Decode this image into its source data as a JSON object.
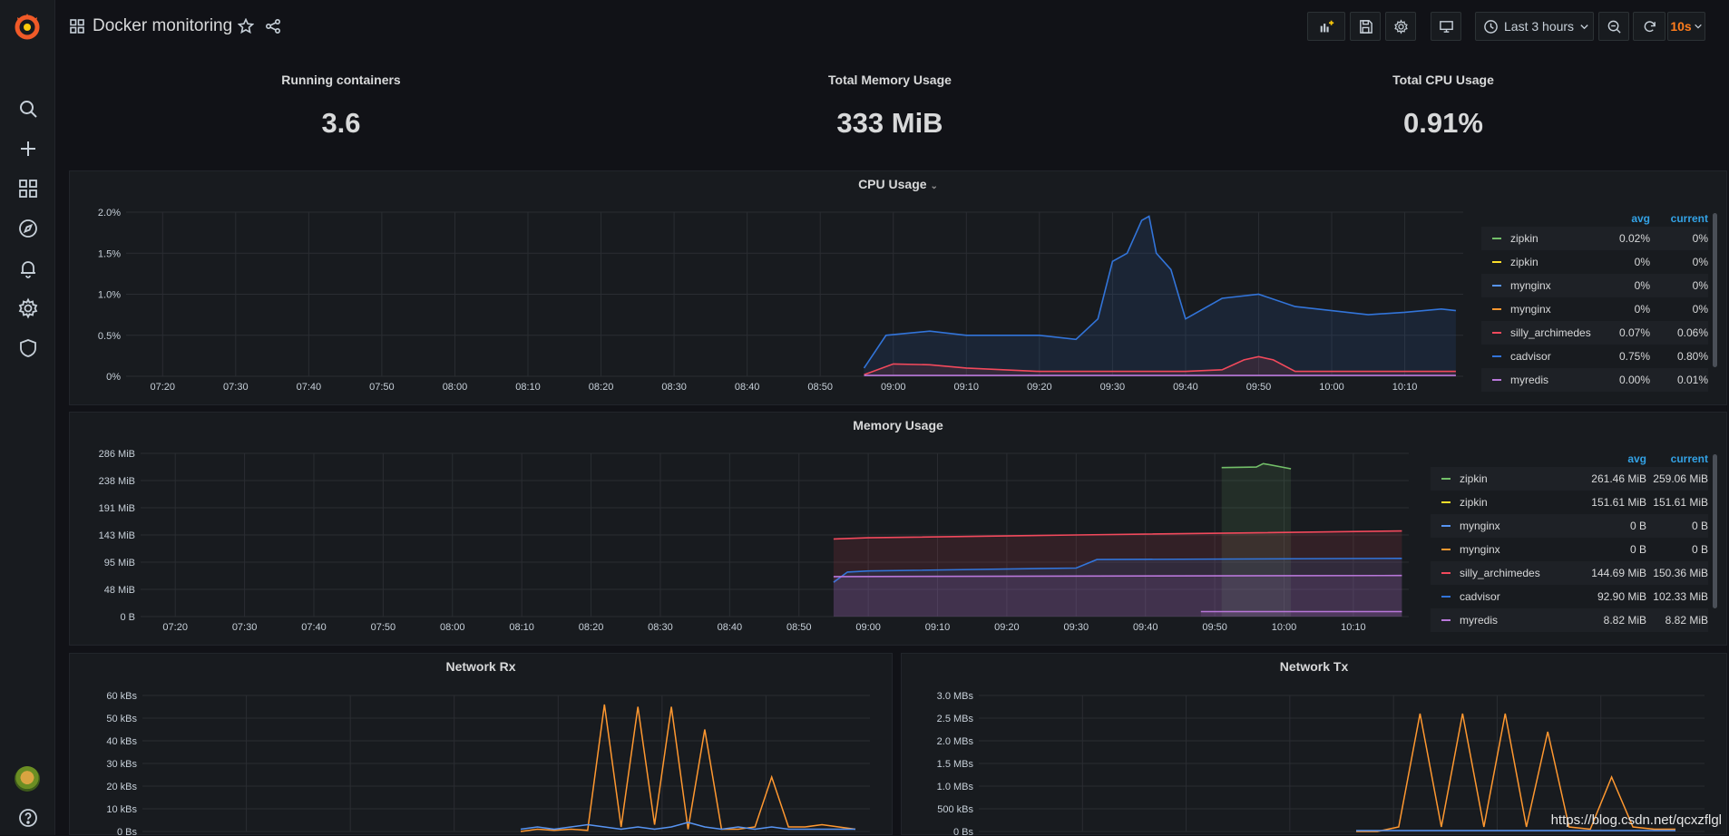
{
  "header": {
    "title": "Docker monitoring",
    "time_range": "Last 3 hours",
    "refresh": "10s"
  },
  "stats": [
    {
      "title": "Running containers",
      "value": "3.6"
    },
    {
      "title": "Total Memory Usage",
      "value": "333 MiB"
    },
    {
      "title": "Total CPU Usage",
      "value": "0.91%"
    }
  ],
  "colors": {
    "zipkin_a": "#73bf69",
    "zipkin_b": "#fade2a",
    "mynginx_a": "#5794f2",
    "mynginx_b": "#ff9830",
    "silly_archimedes": "#f2495c",
    "cadvisor": "#3274d9",
    "myredis": "#b877d9"
  },
  "time_axis": [
    "07:20",
    "07:30",
    "07:40",
    "07:50",
    "08:00",
    "08:10",
    "08:20",
    "08:30",
    "08:40",
    "08:50",
    "09:00",
    "09:10",
    "09:20",
    "09:30",
    "09:40",
    "09:50",
    "10:00",
    "10:10"
  ],
  "cpu_panel": {
    "title": "CPU Usage",
    "legend_headers": {
      "avg": "avg",
      "current": "current"
    },
    "legend": [
      {
        "name": "zipkin",
        "avg": "0.02%",
        "current": "0%",
        "color": "#73bf69"
      },
      {
        "name": "zipkin",
        "avg": "0%",
        "current": "0%",
        "color": "#fade2a"
      },
      {
        "name": "mynginx",
        "avg": "0%",
        "current": "0%",
        "color": "#5794f2"
      },
      {
        "name": "mynginx",
        "avg": "0%",
        "current": "0%",
        "color": "#ff9830"
      },
      {
        "name": "silly_archimedes",
        "avg": "0.07%",
        "current": "0.06%",
        "color": "#f2495c"
      },
      {
        "name": "cadvisor",
        "avg": "0.75%",
        "current": "0.80%",
        "color": "#3274d9"
      },
      {
        "name": "myredis",
        "avg": "0.00%",
        "current": "0.01%",
        "color": "#b877d9"
      }
    ]
  },
  "memory_panel": {
    "title": "Memory Usage",
    "legend_headers": {
      "avg": "avg",
      "current": "current"
    },
    "legend": [
      {
        "name": "zipkin",
        "avg": "261.46 MiB",
        "current": "259.06 MiB",
        "color": "#73bf69"
      },
      {
        "name": "zipkin",
        "avg": "151.61 MiB",
        "current": "151.61 MiB",
        "color": "#fade2a"
      },
      {
        "name": "mynginx",
        "avg": "0 B",
        "current": "0 B",
        "color": "#5794f2"
      },
      {
        "name": "mynginx",
        "avg": "0 B",
        "current": "0 B",
        "color": "#ff9830"
      },
      {
        "name": "silly_archimedes",
        "avg": "144.69 MiB",
        "current": "150.36 MiB",
        "color": "#f2495c"
      },
      {
        "name": "cadvisor",
        "avg": "92.90 MiB",
        "current": "102.33 MiB",
        "color": "#3274d9"
      },
      {
        "name": "myredis",
        "avg": "8.82 MiB",
        "current": "8.82 MiB",
        "color": "#b877d9"
      }
    ]
  },
  "network_rx_panel": {
    "title": "Network Rx"
  },
  "network_tx_panel": {
    "title": "Network Tx"
  },
  "watermark": "https://blog.csdn.net/qcxzflgl",
  "chart_data": [
    {
      "type": "line",
      "title": "CPU Usage",
      "yticks": [
        "0%",
        "0.5%",
        "1.0%",
        "1.5%",
        "2.0%"
      ],
      "ylim": [
        0,
        2.0
      ],
      "x_ticks": [
        "07:20",
        "07:30",
        "07:40",
        "07:50",
        "08:00",
        "08:10",
        "08:20",
        "08:30",
        "08:40",
        "08:50",
        "09:00",
        "09:10",
        "09:20",
        "09:30",
        "09:40",
        "09:50",
        "10:00",
        "10:10"
      ],
      "series": [
        {
          "name": "cadvisor",
          "color": "#3274d9",
          "x": [
            "08:56",
            "08:59",
            "09:05",
            "09:10",
            "09:20",
            "09:25",
            "09:28",
            "09:30",
            "09:32",
            "09:34",
            "09:35",
            "09:36",
            "09:38",
            "09:40",
            "09:45",
            "09:50",
            "09:55",
            "10:00",
            "10:05",
            "10:10",
            "10:15",
            "10:17"
          ],
          "y": [
            0.1,
            0.5,
            0.55,
            0.5,
            0.5,
            0.45,
            0.7,
            1.4,
            1.5,
            1.9,
            1.95,
            1.5,
            1.3,
            0.7,
            0.95,
            1.0,
            0.85,
            0.8,
            0.75,
            0.78,
            0.82,
            0.8
          ]
        },
        {
          "name": "silly_archimedes",
          "color": "#f2495c",
          "x": [
            "08:56",
            "09:00",
            "09:05",
            "09:10",
            "09:20",
            "09:40",
            "09:45",
            "09:48",
            "09:50",
            "09:52",
            "09:55",
            "10:00",
            "10:17"
          ],
          "y": [
            0.02,
            0.15,
            0.14,
            0.1,
            0.06,
            0.06,
            0.08,
            0.2,
            0.24,
            0.2,
            0.06,
            0.06,
            0.06
          ]
        },
        {
          "name": "myredis",
          "color": "#b877d9",
          "x": [
            "08:56",
            "10:17"
          ],
          "y": [
            0.01,
            0.01
          ]
        }
      ]
    },
    {
      "type": "area",
      "title": "Memory Usage",
      "yticks": [
        "0 B",
        "48 MiB",
        "95 MiB",
        "143 MiB",
        "191 MiB",
        "238 MiB",
        "286 MiB"
      ],
      "ylim": [
        0,
        286
      ],
      "x_ticks": [
        "07:20",
        "07:30",
        "07:40",
        "07:50",
        "08:00",
        "08:10",
        "08:20",
        "08:30",
        "08:40",
        "08:50",
        "09:00",
        "09:10",
        "09:20",
        "09:30",
        "09:40",
        "09:50",
        "10:00",
        "10:10"
      ],
      "series": [
        {
          "name": "zipkin",
          "color": "#73bf69",
          "x": [
            "09:51",
            "09:56",
            "09:57",
            "10:01"
          ],
          "y": [
            261,
            262,
            268,
            259
          ]
        },
        {
          "name": "silly_archimedes",
          "color": "#f2495c",
          "x": [
            "08:55",
            "09:00",
            "09:30",
            "10:17"
          ],
          "y": [
            136,
            138,
            143,
            150
          ]
        },
        {
          "name": "cadvisor",
          "color": "#3274d9",
          "x": [
            "08:55",
            "08:57",
            "09:00",
            "09:30",
            "09:33",
            "10:17"
          ],
          "y": [
            60,
            78,
            80,
            85,
            100,
            102
          ]
        },
        {
          "name": "myredis",
          "color": "#b877d9",
          "x": [
            "08:55",
            "10:17"
          ],
          "y": [
            70,
            72
          ]
        },
        {
          "name": "myredis",
          "color": "#b877d9",
          "x": [
            "09:48",
            "10:17"
          ],
          "y": [
            8.8,
            8.8
          ]
        }
      ]
    },
    {
      "type": "line",
      "title": "Network Rx",
      "yticks": [
        "0 Bs",
        "10 kBs",
        "20 kBs",
        "30 kBs",
        "40 kBs",
        "50 kBs",
        "60 kBs"
      ],
      "ylim": [
        0,
        60
      ],
      "series": [
        {
          "name": "",
          "color": "#ff9830",
          "y": [
            0,
            1,
            0.5,
            1,
            0.5,
            56,
            2,
            55,
            3,
            55,
            1,
            45,
            1,
            1,
            2,
            24,
            2,
            2,
            3,
            2,
            1
          ]
        },
        {
          "name": "",
          "color": "#5794f2",
          "y": [
            1,
            2,
            1,
            2,
            3,
            2,
            1,
            2,
            1,
            2,
            4,
            2,
            1,
            2,
            1,
            2,
            1,
            1,
            1,
            1,
            1
          ]
        }
      ]
    },
    {
      "type": "line",
      "title": "Network Tx",
      "yticks": [
        "0 Bs",
        "500 kBs",
        "1.0 MBs",
        "1.5 MBs",
        "2.0 MBs",
        "2.5 MBs",
        "3.0 MBs"
      ],
      "ylim": [
        0,
        3.0
      ],
      "series": [
        {
          "name": "",
          "color": "#ff9830",
          "y": [
            0,
            0,
            0.1,
            2.6,
            0.1,
            2.6,
            0.1,
            2.6,
            0.1,
            2.2,
            0.1,
            0.05,
            1.2,
            0.1,
            0.05,
            0.05
          ]
        },
        {
          "name": "",
          "color": "#5794f2",
          "y": [
            0.02,
            0.02,
            0.02,
            0.02,
            0.02,
            0.02,
            0.02,
            0.02,
            0.02,
            0.02,
            0.02,
            0.02,
            0.02,
            0.02,
            0.02,
            0.02
          ]
        }
      ]
    }
  ]
}
